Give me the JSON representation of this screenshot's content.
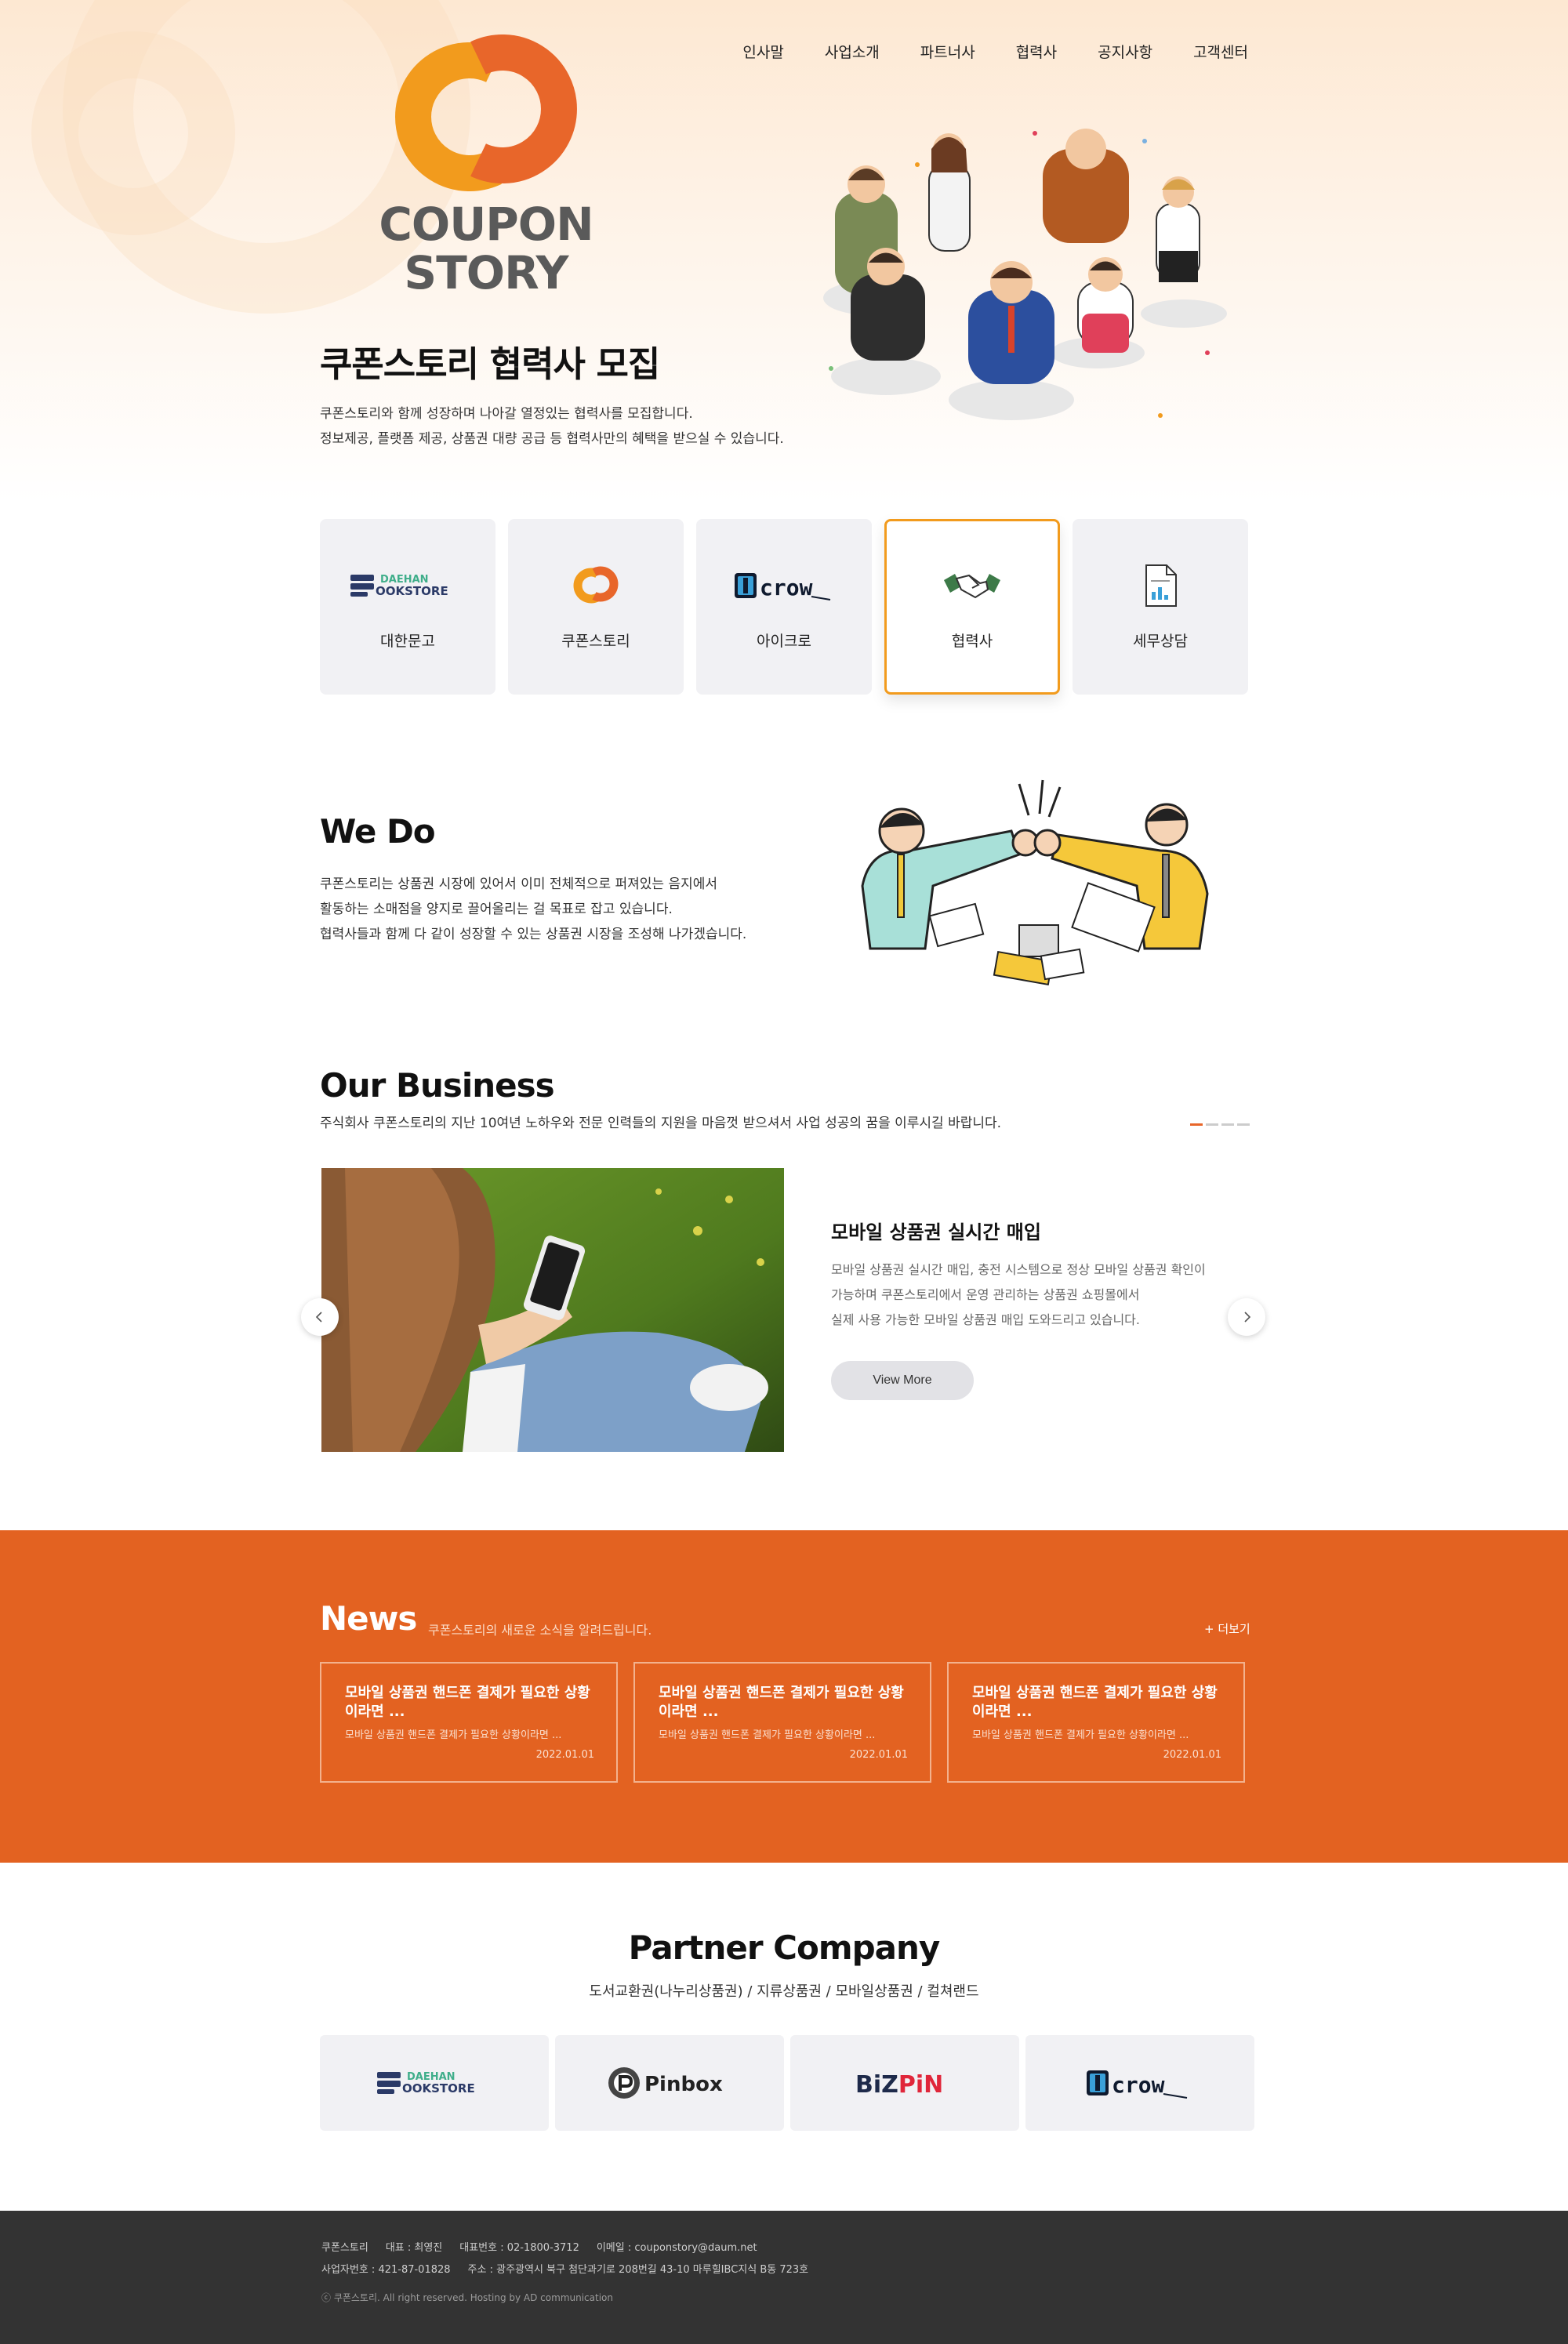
{
  "brand": {
    "logo_line1": "COUPON",
    "logo_line2": "STORY",
    "orange": "#e8662a",
    "amber": "#f29b1d"
  },
  "nav": {
    "items": [
      "인사말",
      "사업소개",
      "파트너사",
      "협력사",
      "공지사항",
      "고객센터"
    ]
  },
  "hero": {
    "title": "쿠폰스토리 협력사 모집",
    "desc_line1": "쿠폰스토리와 함께 성장하며 나아갈 열정있는 협력사를 모집합니다.",
    "desc_line2": "정보제공, 플랫폼 제공, 상품권 대량 공급 등 협력사만의 혜택을 받으실 수 있습니다."
  },
  "cards": [
    {
      "label": "대한문고",
      "icon": "daehan-bookstore-logo"
    },
    {
      "label": "쿠폰스토리",
      "icon": "couponstory-logo-icon"
    },
    {
      "label": "아이크로",
      "icon": "icrow-logo"
    },
    {
      "label": "협력사",
      "icon": "handshake-icon"
    },
    {
      "label": "세무상담",
      "icon": "document-chart-icon"
    }
  ],
  "cards_active": "협력사",
  "logo_text": {
    "daehan_top": "DAEHAN",
    "daehan_bottom": "OOKSTORE",
    "icrow": "crow",
    "pinbox": "Pinbox",
    "bizpin_a": "BiZ",
    "bizpin_b": "PiN"
  },
  "wedo": {
    "title": "We Do",
    "line1": "쿠폰스토리는 상품권 시장에 있어서 이미 전체적으로 퍼져있는 음지에서",
    "line2": "활동하는 소매점을 양지로 끌어올리는 걸 목표로 잡고 있습니다.",
    "line3": "협력사들과 함께 다 같이 성장할 수 있는 상품권 시장을 조성해 나가겠습니다."
  },
  "business": {
    "title": "Our Business",
    "desc": "주식회사 쿠폰스토리의 지난 10여년 노하우와 전문 인력들의 지원을 마음껏 받으셔서 사업 성공의 꿈을 이루시길 바랍니다.",
    "slide_title": "모바일 상품권 실시간 매입",
    "slide_line1": "모바일 상품권 실시간 매입, 충전 시스템으로 정상 모바일 상품권 확인이",
    "slide_line2": "가능하며 쿠폰스토리에서 운영 관리하는 상품권 쇼핑몰에서",
    "slide_line3": "실제 사용 가능한 모바일 상품권 매입 도와드리고 있습니다.",
    "view_more": "View More"
  },
  "news": {
    "title": "News",
    "subtitle": "쿠폰스토리의 새로운 소식을 알려드립니다.",
    "more": "+ 더보기",
    "items": [
      {
        "title": "모바일 상품권 핸드폰 결제가 필요한 상황이라면 ...",
        "desc": "모바일 상품권 핸드폰 결제가 필요한 상황이라면 ...",
        "date": "2022.01.01"
      },
      {
        "title": "모바일 상품권 핸드폰 결제가 필요한 상황이라면 ...",
        "desc": "모바일 상품권 핸드폰 결제가 필요한 상황이라면 ...",
        "date": "2022.01.01"
      },
      {
        "title": "모바일 상품권 핸드폰 결제가 필요한 상황이라면 ...",
        "desc": "모바일 상품권 핸드폰 결제가 필요한 상황이라면 ...",
        "date": "2022.01.01"
      }
    ]
  },
  "partners": {
    "title": "Partner Company",
    "subtitle": "도서교환권(나누리상품권) / 지류상품권 / 모바일상품권 / 컬쳐랜드"
  },
  "footer": {
    "company": "쿠폰스토리",
    "ceo": "대표 : 최영진",
    "phone": "대표번호 : 02-1800-3712",
    "email": "이메일 : couponstory@daum.net",
    "bizno": "사업자번호 : 421-87-01828",
    "address": "주소 : 광주광역시 북구 첨단과기로 208번길 43-10 마루힐IBC지식 B동 723호",
    "copyright": "ⓒ 쿠폰스토리. All right reserved. Hosting by AD communication"
  }
}
